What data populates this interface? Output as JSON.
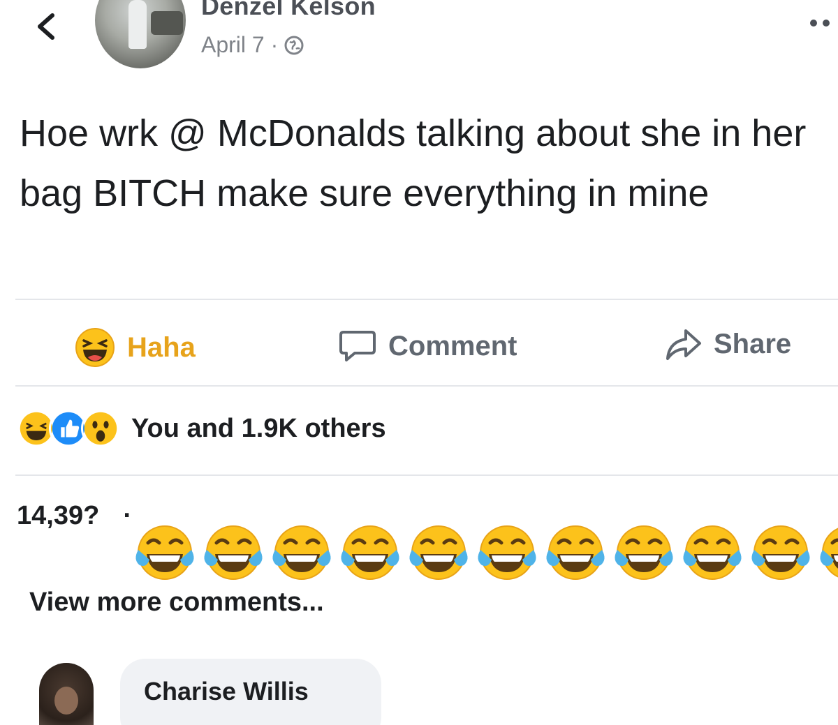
{
  "post": {
    "author": "Denzel Kelson",
    "date": "April 7 ·",
    "privacy_icon": "globe-icon",
    "text": "Hoe wrk @ McDonalds talking about she in her bag BITCH make sure everything in mine"
  },
  "actions": {
    "haha_label": "Haha",
    "comment_label": "Comment",
    "share_label": "Share"
  },
  "reactions": {
    "icons": [
      "haha-icon",
      "like-icon",
      "wow-icon"
    ],
    "summary": "You and 1.9K others"
  },
  "comments": {
    "count": "14,39?",
    "count_dot": "·",
    "emoji_reply": [
      "😂",
      "😂",
      "😂",
      "😂",
      "😂",
      "😂",
      "😂",
      "😂",
      "😂",
      "😂",
      "😂"
    ],
    "view_more": "View more comments...",
    "first_commenter": "Charise Willis"
  },
  "colors": {
    "haha_accent": "#e7a31b",
    "muted_text": "#606770",
    "bubble_bg": "#f0f2f5",
    "emoji_yellow": "#fcc21b",
    "tear_blue": "#4fb3e8"
  }
}
